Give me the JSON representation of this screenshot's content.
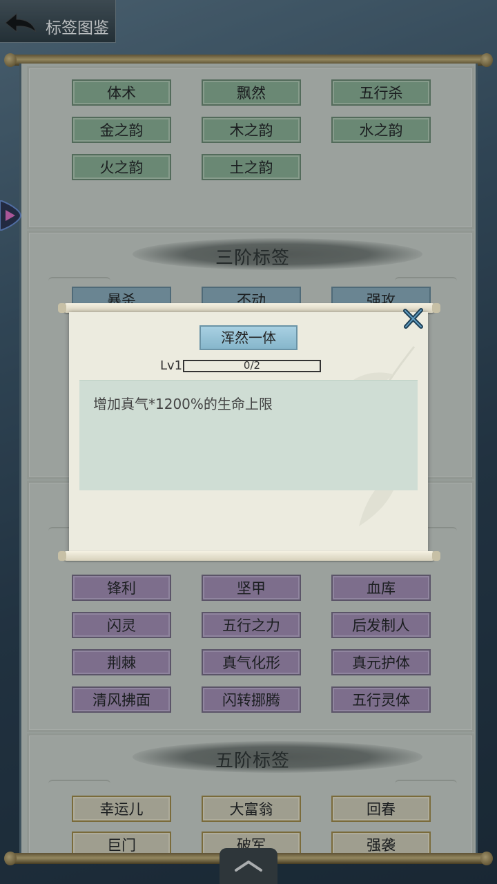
{
  "header": {
    "title": "标签图鉴"
  },
  "sections": {
    "tier2": {
      "tags": [
        "体术",
        "飘然",
        "五行杀",
        "金之韵",
        "木之韵",
        "水之韵",
        "火之韵",
        "土之韵"
      ]
    },
    "tier3": {
      "title": "三阶标签",
      "tags": [
        "暴杀",
        "不动",
        "强攻"
      ]
    },
    "tier4": {
      "tags": [
        "锋利",
        "坚甲",
        "血库",
        "闪灵",
        "五行之力",
        "后发制人",
        "荆棘",
        "真气化形",
        "真元护体",
        "清风拂面",
        "闪转挪腾",
        "五行灵体"
      ]
    },
    "tier5": {
      "title": "五阶标签",
      "tags": [
        "幸运儿",
        "大富翁",
        "回春",
        "巨门",
        "破军",
        "强袭"
      ]
    }
  },
  "modal": {
    "tag_name": "浑然一体",
    "level_label": "Lv1",
    "progress_text": "0/2",
    "progress": 0.0,
    "description": "增加真气*1200%的生命上限"
  },
  "colors": {
    "green_tag": "#8fb496",
    "blue_tag": "#8fb1c0",
    "purple_tag": "#a990b8",
    "gold_tag": "#d9d3bc"
  }
}
